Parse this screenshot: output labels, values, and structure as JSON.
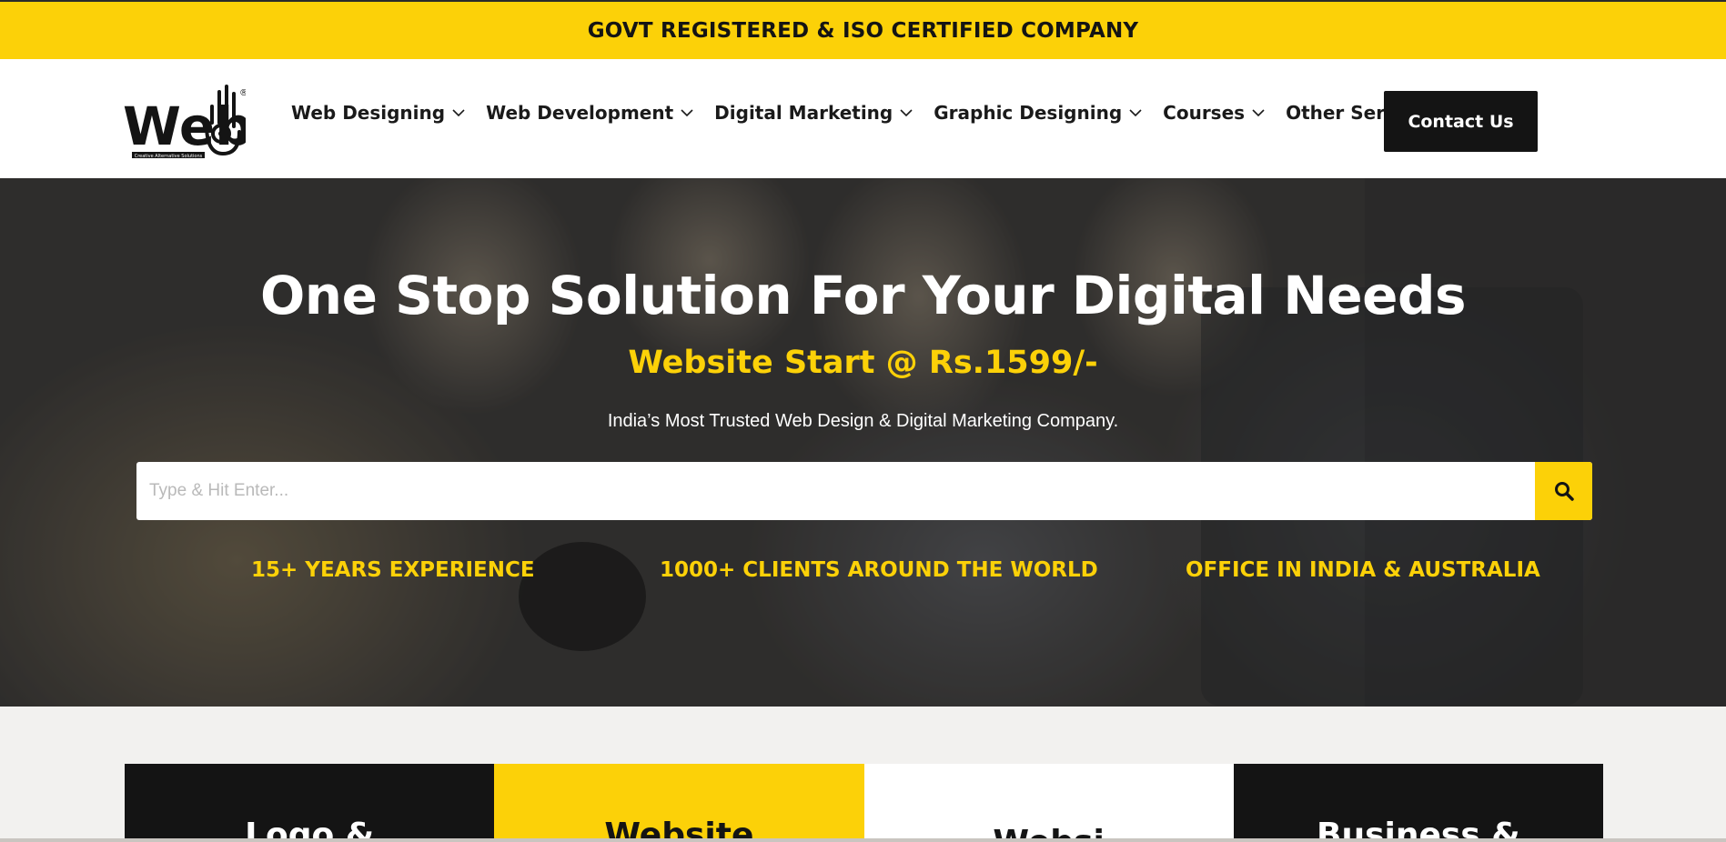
{
  "topbar": {
    "text": "GOVT REGISTERED & ISO CERTIFIED COMPANY"
  },
  "header": {
    "logo_text": "Web",
    "logo_tagline": "Creative Alternative Solutions",
    "logo_mark": "®",
    "nav": [
      {
        "label": "Web Designing"
      },
      {
        "label": "Web Development"
      },
      {
        "label": "Digital Marketing"
      },
      {
        "label": "Graphic Designing"
      },
      {
        "label": "Courses"
      },
      {
        "label": "Other Services"
      }
    ],
    "contact_label": "Contact Us"
  },
  "hero": {
    "title": "One Stop Solution For Your Digital Needs",
    "subtitle": "Website Start @ Rs.1599/-",
    "tagline": "India’s Most Trusted Web Design & Digital Marketing Company.",
    "search_placeholder": "Type & Hit Enter...",
    "stats": [
      {
        "label": "15+ YEARS EXPERIENCE"
      },
      {
        "label": "1000+ CLIENTS AROUND THE WORLD"
      },
      {
        "label": "OFFICE IN INDIA & AUSTRALIA"
      }
    ]
  },
  "cards": [
    {
      "label": "Logo &",
      "bg": "#141414",
      "fg": "#ffffff"
    },
    {
      "label": "Website",
      "bg": "#fcd108",
      "fg": "#141414"
    },
    {
      "label": "Websi",
      "bg": "#ffffff",
      "fg": "#141414"
    },
    {
      "label": "Business &",
      "bg": "#141414",
      "fg": "#ffffff"
    }
  ],
  "colors": {
    "accent": "#fcd108",
    "dark": "#141414",
    "white": "#ffffff"
  }
}
